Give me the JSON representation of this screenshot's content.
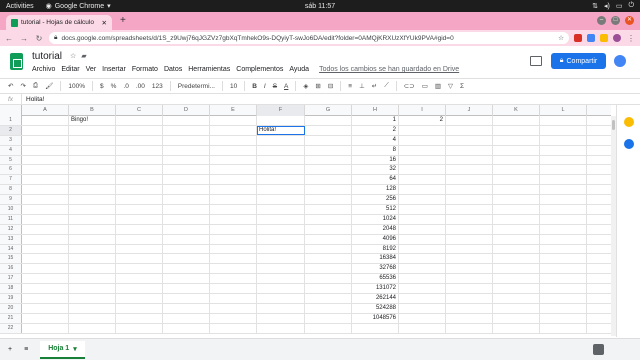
{
  "os_bar": {
    "activities": "Activities",
    "app_name": "Google Chrome",
    "clock": "sáb 11:57"
  },
  "browser": {
    "tab_title": "tutorial - Hojas de cálculo",
    "url": "docs.google.com/spreadsheets/d/1S_z9Uwj76qJGZVz7gbXqTmhekO9s-DQyiyT-swJo6DA/edit?folder=0AMQjKRXUzXfYUk9PVA#gid=0"
  },
  "doc": {
    "title": "tutorial",
    "menu": [
      "Archivo",
      "Editar",
      "Ver",
      "Insertar",
      "Formato",
      "Datos",
      "Herramientas",
      "Complementos",
      "Ayuda"
    ],
    "saved_status": "Todos los cambios se han guardado en Drive",
    "share_label": "Compartir"
  },
  "toolbar": {
    "zoom": "100%",
    "currency": "$",
    "percent": "%",
    "dec_less": ".0",
    "dec_more": ".00",
    "format_more": "123",
    "font": "Predetermi...",
    "font_size": "10",
    "bold": "B",
    "italic": "I",
    "strike": "S",
    "text_color": "A",
    "sum": "Σ"
  },
  "formula_bar": {
    "fx": "fx",
    "content": "Holita!"
  },
  "columns": [
    "A",
    "B",
    "C",
    "D",
    "E",
    "F",
    "G",
    "H",
    "I",
    "J",
    "K",
    "L"
  ],
  "rows": [
    "1",
    "2",
    "3",
    "4",
    "5",
    "6",
    "7",
    "8",
    "9",
    "10",
    "11",
    "12",
    "13",
    "14",
    "15",
    "16",
    "17",
    "18",
    "19",
    "20",
    "21",
    "22"
  ],
  "cells": {
    "B1": "Bingo!",
    "F2": "Holita!",
    "I1": "2",
    "H": [
      "1",
      "2",
      "4",
      "8",
      "16",
      "32",
      "64",
      "128",
      "256",
      "512",
      "1024",
      "2048",
      "4096",
      "8192",
      "16384",
      "32768",
      "65536",
      "131072",
      "262144",
      "524288",
      "1048576",
      ""
    ]
  },
  "sheet_tab": {
    "label": "Hoja 1"
  }
}
